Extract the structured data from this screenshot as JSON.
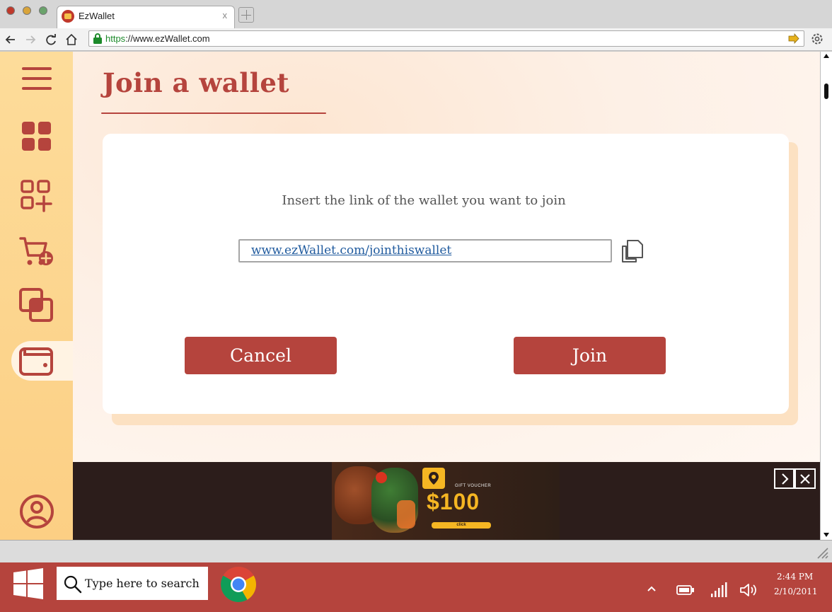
{
  "browser": {
    "tab_title": "EzWallet",
    "tab_close": "x",
    "url_scheme": "https",
    "url_rest": "://www.ezWallet.com"
  },
  "sidebar": {
    "items": [
      {
        "name": "menu",
        "icon": "hamburger-menu-icon"
      },
      {
        "name": "dashboard",
        "icon": "grid-icon"
      },
      {
        "name": "add-category",
        "icon": "grid-add-icon"
      },
      {
        "name": "add-purchase",
        "icon": "cart-add-icon"
      },
      {
        "name": "wallets",
        "icon": "overlapping-squares-icon"
      },
      {
        "name": "wallet",
        "icon": "wallet-icon",
        "active": true
      },
      {
        "name": "profile",
        "icon": "user-icon"
      }
    ]
  },
  "main": {
    "title": "Join a wallet",
    "prompt": "Insert the link of the wallet you want to join",
    "link_value": "www.ezWallet.com/jointhiswallet",
    "cancel_label": "Cancel",
    "join_label": "Join"
  },
  "ad": {
    "voucher_label": "GIFT VOUCHER",
    "amount": "$100",
    "cta": "click"
  },
  "taskbar": {
    "search_placeholder": "Type here to search",
    "time": "2:44 PM",
    "date": "2/10/2011"
  },
  "colors": {
    "accent": "#b5443d",
    "sidebar_bg": "#fcd690",
    "ad_accent": "#f5b623",
    "link": "#1f5a9e"
  }
}
